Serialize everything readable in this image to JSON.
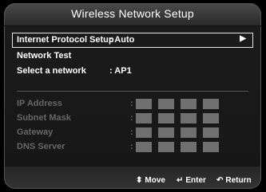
{
  "window": {
    "title": "Wireless Network Setup"
  },
  "menu": {
    "items": [
      {
        "label": "Internet Protocol Setup",
        "value": ": Auto",
        "selected": true,
        "arrow_icon": "right-triangle-icon"
      },
      {
        "label": "Network Test",
        "value": ""
      },
      {
        "label": "Select a network",
        "value": ": AP1"
      }
    ]
  },
  "ip_settings": {
    "fields": [
      {
        "label": "IP Address",
        "colon": ":"
      },
      {
        "label": "Subnet Mask",
        "colon": ":"
      },
      {
        "label": "Gateway",
        "colon": ":"
      },
      {
        "label": "DNS Server",
        "colon": ":"
      }
    ],
    "octet_boxes_per_field": 4,
    "disabled": true
  },
  "footer": {
    "move": {
      "icon": "up-down-arrow-icon",
      "label": "Move"
    },
    "enter": {
      "icon": "enter-icon",
      "label": "Enter"
    },
    "return": {
      "icon": "return-icon",
      "label": "Return"
    }
  },
  "colors": {
    "background": "#000000",
    "panel": "#1b1b1b",
    "text": "#ffffff",
    "disabled_text": "#666666",
    "octet_box": "#707070"
  }
}
